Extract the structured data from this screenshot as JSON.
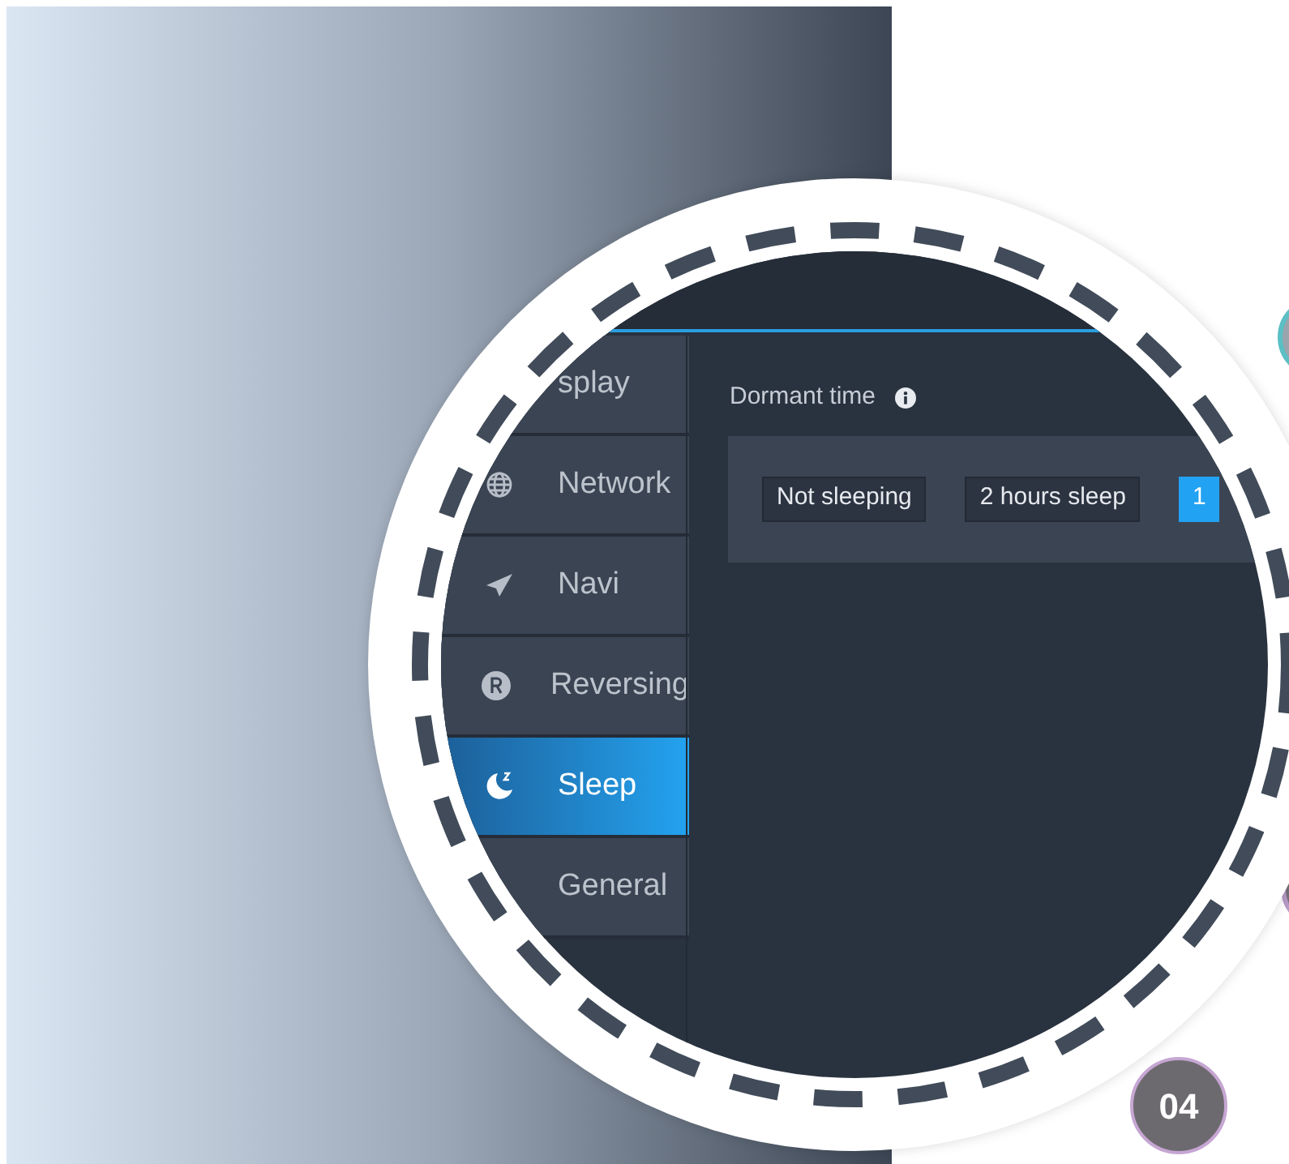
{
  "sidebar": {
    "items": [
      {
        "label": "splay",
        "kind": "display",
        "selected": false
      },
      {
        "label": "Network",
        "kind": "network",
        "selected": false
      },
      {
        "label": "Navi",
        "kind": "navi",
        "selected": false
      },
      {
        "label": "Reversing",
        "kind": "reversing",
        "selected": false
      },
      {
        "label": "Sleep",
        "kind": "sleep",
        "selected": true
      },
      {
        "label": "General",
        "kind": "general",
        "selected": false
      }
    ]
  },
  "setting": {
    "label": "Dormant time",
    "options": [
      {
        "label": "Not sleeping",
        "selected": false
      },
      {
        "label": "2 hours sleep",
        "selected": false
      },
      {
        "label": "1",
        "selected": true
      }
    ]
  },
  "page_number": "04"
}
